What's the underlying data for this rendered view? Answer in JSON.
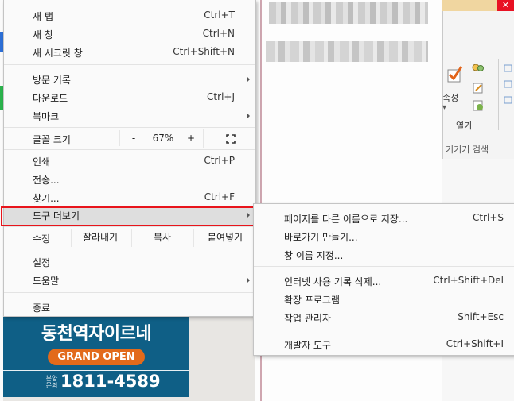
{
  "main_menu": {
    "new_tab": {
      "label": "새 탭",
      "shortcut": "Ctrl+T"
    },
    "new_window": {
      "label": "새 창",
      "shortcut": "Ctrl+N"
    },
    "incognito": {
      "label": "새 시크릿 창",
      "shortcut": "Ctrl+Shift+N"
    },
    "history": {
      "label": "방문 기록"
    },
    "downloads": {
      "label": "다운로드",
      "shortcut": "Ctrl+J"
    },
    "bookmarks": {
      "label": "북마크"
    },
    "zoom": {
      "label": "글꼴 크기",
      "minus": "-",
      "value": "67%",
      "plus": "+"
    },
    "print": {
      "label": "인쇄",
      "shortcut": "Ctrl+P"
    },
    "cast": {
      "label": "전송..."
    },
    "find": {
      "label": "찾기...",
      "shortcut": "Ctrl+F"
    },
    "more_tools": {
      "label": "도구 더보기"
    },
    "edit": {
      "label": "수정",
      "cut": "잘라내기",
      "copy": "복사",
      "paste": "붙여넣기"
    },
    "settings": {
      "label": "설정"
    },
    "help": {
      "label": "도움말"
    },
    "exit": {
      "label": "종료"
    }
  },
  "sub_menu": {
    "save_page": {
      "label": "페이지를 다른 이름으로 저장...",
      "shortcut": "Ctrl+S"
    },
    "create_shortcut": {
      "label": "바로가기 만들기..."
    },
    "name_window": {
      "label": "창 이름 지정..."
    },
    "clear_data": {
      "label": "인터넷 사용 기록 삭제...",
      "shortcut": "Ctrl+Shift+Del"
    },
    "extensions": {
      "label": "확장 프로그램"
    },
    "task_manager": {
      "label": "작업 관리자",
      "shortcut": "Shift+Esc"
    },
    "dev_tools": {
      "label": "개발자 도구",
      "shortcut": "Ctrl+Shift+I"
    }
  },
  "background": {
    "ribbon_button_label": "속성",
    "ribbon_group_label": "열기",
    "ribbon_search": "기기기 검색",
    "window_close": "✕"
  },
  "ad": {
    "title": "동천역자이르네",
    "badge": "GRAND OPEN",
    "phone_label": "분양 문의",
    "phone": "1811-4589"
  },
  "colors": {
    "highlight_border": "#e8141b",
    "ad_background": "#0f5f86",
    "ad_badge": "#e26a1b",
    "hover_row": "#dedede"
  }
}
